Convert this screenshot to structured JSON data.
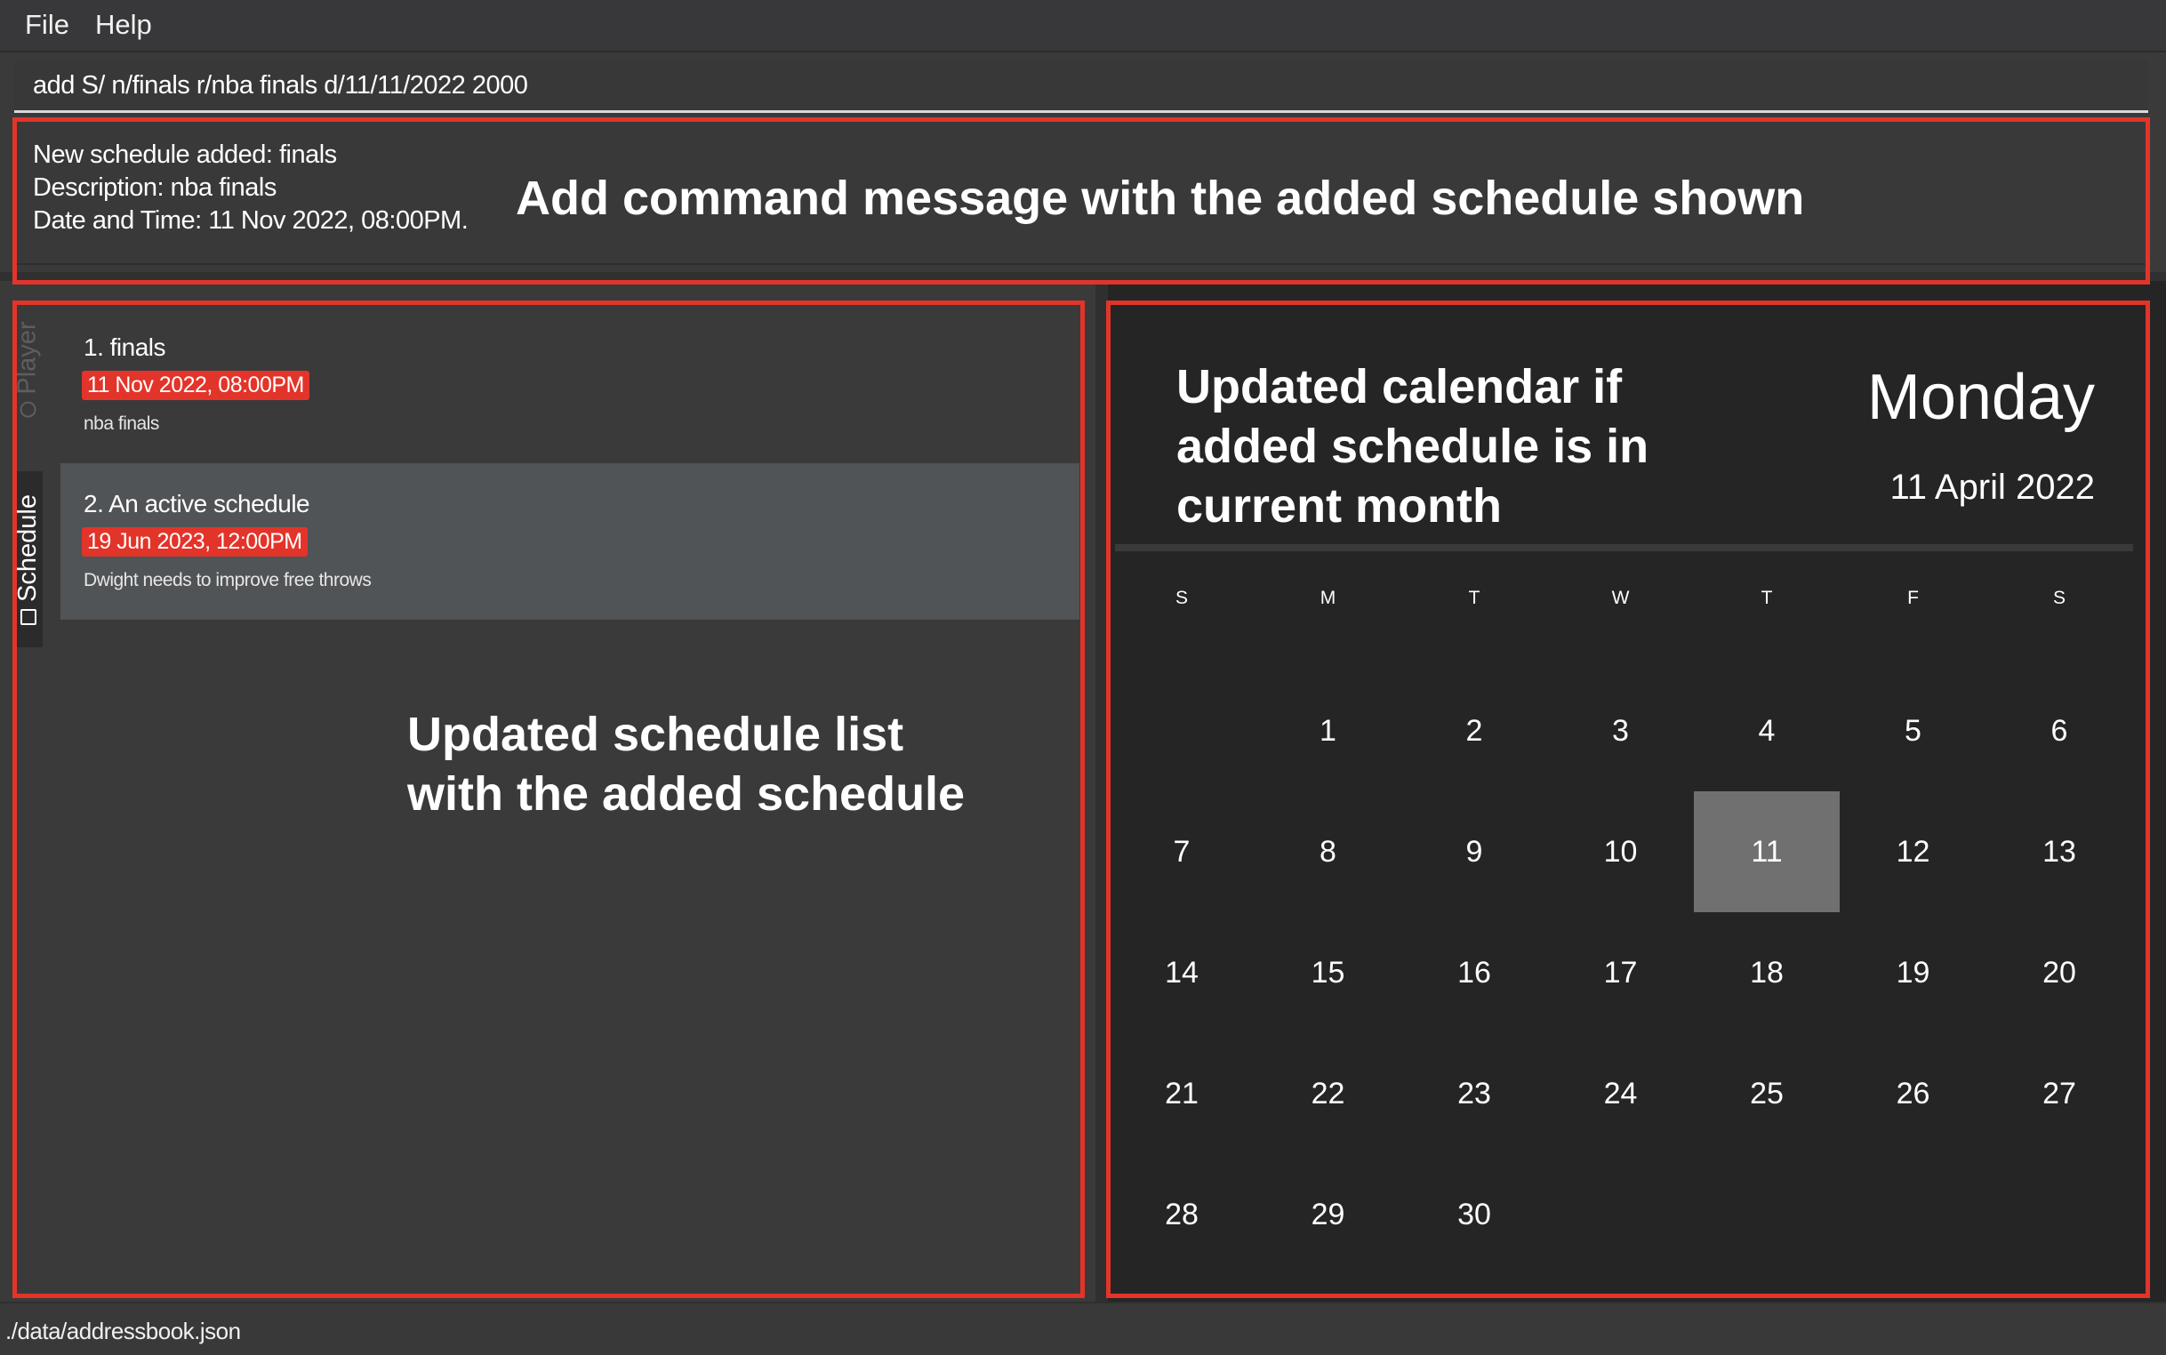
{
  "menu": {
    "file": "File",
    "help": "Help"
  },
  "command": {
    "text": "add S/ n/finals r/nba finals d/11/11/2022 2000"
  },
  "result": {
    "line1": "New schedule added: finals",
    "line2": "Description: nba finals",
    "line3": "Date and Time: 11 Nov 2022, 08:00PM."
  },
  "tabs": {
    "player": "Player",
    "schedule": "Schedule",
    "player_icon": "person-icon",
    "schedule_icon": "calendar-icon"
  },
  "schedules": [
    {
      "title": "1.  finals",
      "datetime": "11 Nov 2022, 08:00PM",
      "description": "nba finals"
    },
    {
      "title": "2.  An active schedule",
      "datetime": "19 Jun 2023, 12:00PM",
      "description": "Dwight needs to improve free throws"
    }
  ],
  "calendar": {
    "day_name": "Monday",
    "date_label": "11 April 2022",
    "weekdays": [
      "S",
      "M",
      "T",
      "W",
      "T",
      "F",
      "S"
    ],
    "first_weekday_index": 1,
    "days_in_month": 30,
    "highlighted_day": 11
  },
  "status": {
    "path": "./data/addressbook.json"
  },
  "annotations": {
    "result": "Add command message with the added schedule shown",
    "list_line1": "Updated schedule list",
    "list_line2": "with the added schedule",
    "calendar_line1": "Updated calendar if",
    "calendar_line2": "added schedule is in",
    "calendar_line3": "current month"
  },
  "colors": {
    "accent_red": "#e3342a",
    "background": "#3a3a3b",
    "calendar_bg": "#252526",
    "today_cell": "#707070"
  }
}
